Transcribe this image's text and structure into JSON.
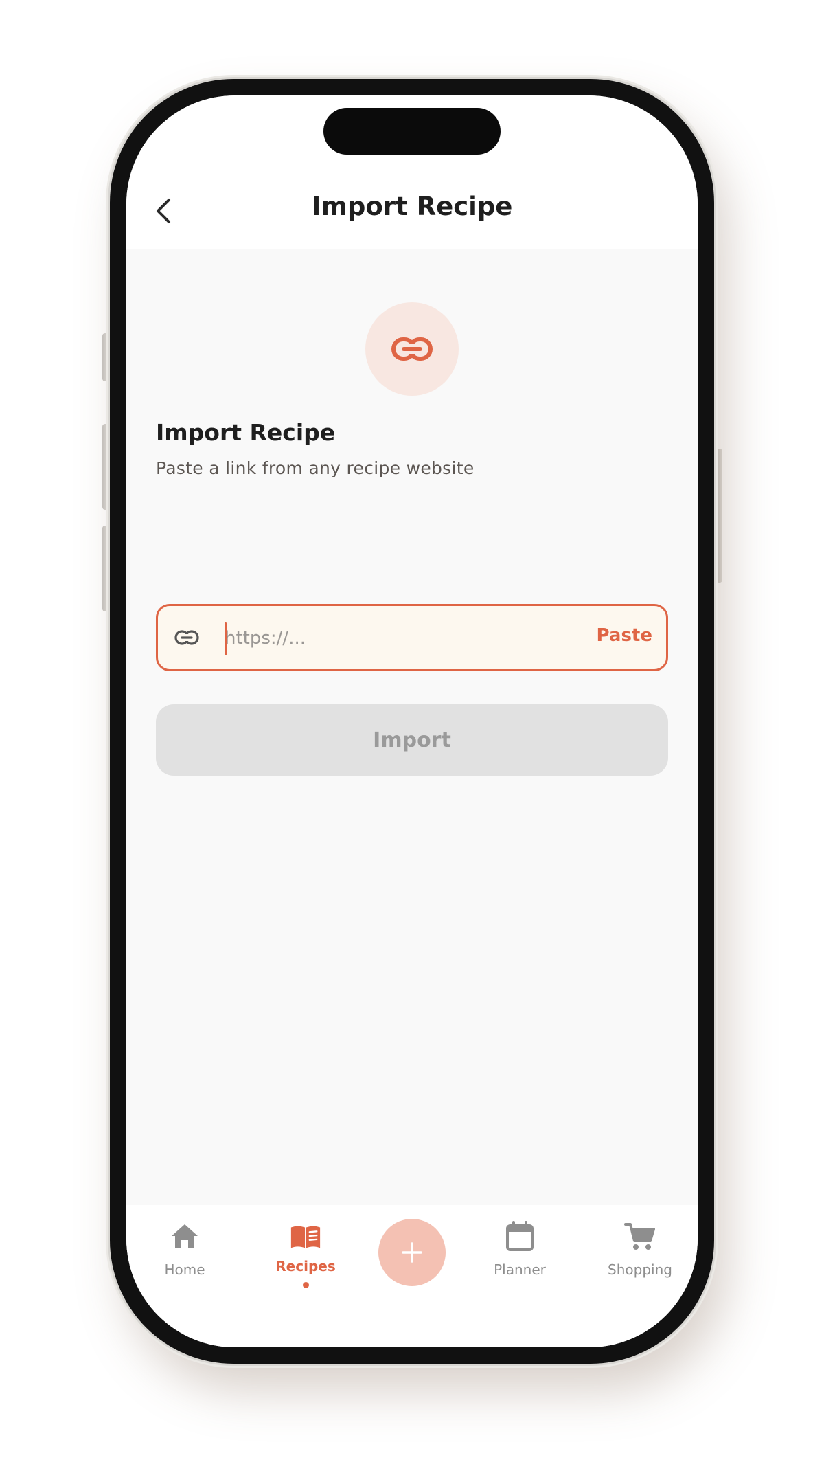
{
  "header": {
    "title": "Import Recipe",
    "back_icon": "chevron-left-icon"
  },
  "import": {
    "badge_icon": "link-icon",
    "title": "Import Recipe",
    "subtitle": "Paste a link from any recipe website",
    "url_input": {
      "value": "",
      "placeholder": "https://...",
      "icon": "link-icon"
    },
    "paste_label": "Paste",
    "import_label": "Import"
  },
  "nav": {
    "items": [
      {
        "label": "Home",
        "icon": "home-icon",
        "active": false
      },
      {
        "label": "Recipes",
        "icon": "recipe-book-icon",
        "active": true
      },
      {
        "label": "Planner",
        "icon": "calendar-icon",
        "active": false
      },
      {
        "label": "Shopping",
        "icon": "shopping-cart-icon",
        "active": false
      }
    ],
    "fab_icon": "plus-icon"
  },
  "colors": {
    "accent": "#df6545",
    "accent_soft": "#f8e7e1",
    "fab": "#f4c1b3",
    "field_bg": "#fdf8ef",
    "disabled_button": "#e1e1e1",
    "inactive_nav": "#8e8e8e"
  }
}
